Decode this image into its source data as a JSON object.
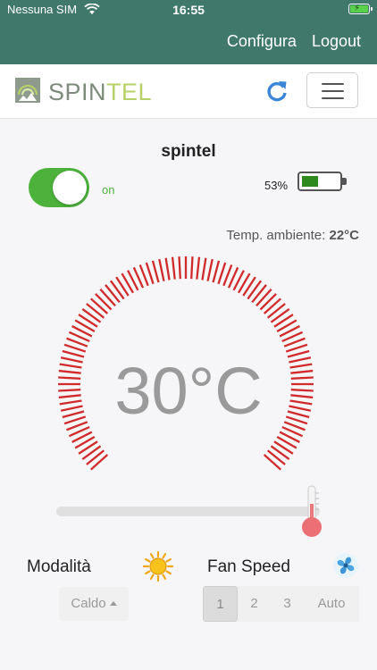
{
  "status_bar": {
    "carrier": "Nessuna SIM",
    "time": "16:55"
  },
  "nav": {
    "configure_label": "Configura",
    "logout_label": "Logout"
  },
  "brand": {
    "name_part1": "SPIN",
    "name_part2": "TEL"
  },
  "icons": {
    "refresh": "refresh-icon",
    "menu": "hamburger-menu-icon",
    "sun": "sun-icon",
    "fan": "fan-icon",
    "thermometer": "thermometer-icon"
  },
  "device": {
    "name": "spintel",
    "power_state": "on",
    "battery_percent_label": "53%",
    "battery_level": 0.53,
    "ambient_label": "Temp. ambiente:",
    "ambient_value": "22°C"
  },
  "thermostat": {
    "setpoint_label": "30°C",
    "setpoint_fraction": 0.97
  },
  "controls": {
    "mode_label": "Modalità",
    "mode_value": "Caldo",
    "fan_label": "Fan Speed",
    "fan_speeds": [
      "1",
      "2",
      "3",
      "Auto"
    ],
    "fan_selected": "1"
  },
  "colors": {
    "app_bar": "#40786c",
    "toggle_on": "#4cb23b",
    "dial_ticks": "#d12a2a",
    "refresh": "#3b86d6"
  }
}
